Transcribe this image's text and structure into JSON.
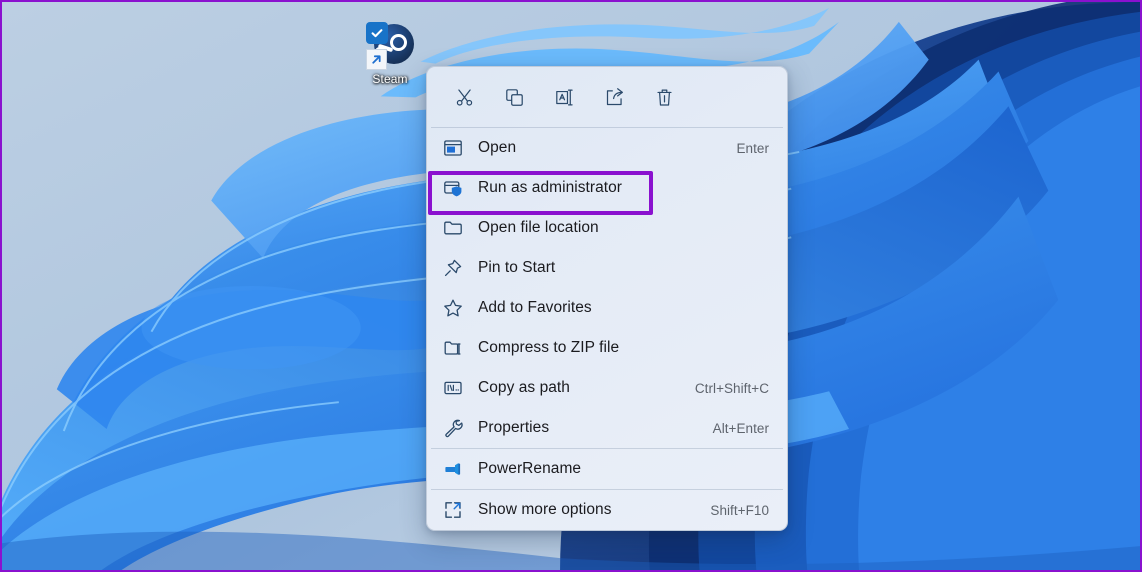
{
  "desktop": {
    "wallpaper_name": "windows-11-bloom-wallpaper",
    "background_color": "#b3c9e0",
    "icon": {
      "label": "Steam",
      "app_icon": "steam-icon",
      "sync_badge": "onedrive-synced-check-icon",
      "shortcut_badge": "shortcut-arrow-icon"
    }
  },
  "context_menu": {
    "toolbar": [
      {
        "name": "cut-icon",
        "title": "Cut"
      },
      {
        "name": "copy-icon",
        "title": "Copy"
      },
      {
        "name": "rename-icon",
        "title": "Rename"
      },
      {
        "name": "share-icon",
        "title": "Share"
      },
      {
        "name": "delete-icon",
        "title": "Delete"
      }
    ],
    "items": [
      {
        "icon": "open-window-icon",
        "label": "Open",
        "accel": "Enter"
      },
      {
        "icon": "shield-admin-icon",
        "label": "Run as administrator",
        "accel": ""
      },
      {
        "icon": "folder-icon",
        "label": "Open file location",
        "accel": ""
      },
      {
        "icon": "pin-icon",
        "label": "Pin to Start",
        "accel": ""
      },
      {
        "icon": "star-icon",
        "label": "Add to Favorites",
        "accel": ""
      },
      {
        "icon": "zip-folder-icon",
        "label": "Compress to ZIP file",
        "accel": ""
      },
      {
        "icon": "copy-path-icon",
        "label": "Copy as path",
        "accel": "Ctrl+Shift+C"
      },
      {
        "icon": "wrench-icon",
        "label": "Properties",
        "accel": "Alt+Enter"
      },
      {
        "icon": "powerrename-icon",
        "label": "PowerRename",
        "accel": ""
      },
      {
        "icon": "show-more-options-icon",
        "label": "Show more options",
        "accel": "Shift+F10"
      }
    ]
  },
  "annotation": {
    "highlight_target": "Run as administrator",
    "highlight_color": "#8a11cf",
    "border_color": "#8a11cf"
  }
}
